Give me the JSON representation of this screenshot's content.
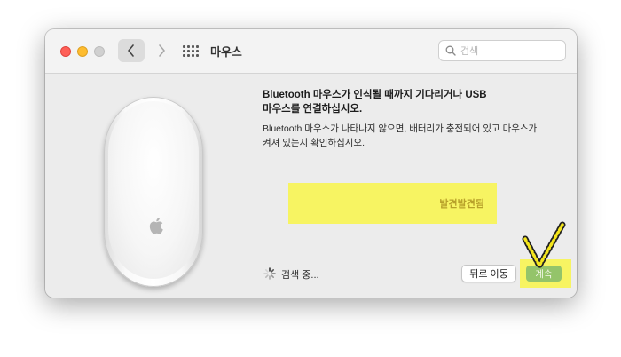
{
  "window": {
    "title": "마우스",
    "search_placeholder": "검색"
  },
  "main": {
    "heading_line1": "Bluetooth 마우스가 인식될 때까지 기다리거나 USB",
    "heading_line2": "마우스를 연결하십시오.",
    "desc_line1": "Bluetooth 마우스가 나타나지 않으면, 배터리가 충전되어 있고 마우스가",
    "desc_line2": "켜져 있는지 확인하십시오.",
    "found_label": "발견발견됨",
    "status_text": "검색 중..."
  },
  "footer": {
    "back_label": "뒤로 이동",
    "continue_label": "계속"
  },
  "colors": {
    "highlight": "#f7f462",
    "continue_button": "#94c46a",
    "checkmark": "#f5e61c"
  },
  "icons": [
    "chevron-left-icon",
    "chevron-right-icon",
    "grid-icon",
    "search-icon",
    "apple-logo-icon",
    "spinner-icon",
    "checkmark-annotation-icon"
  ]
}
